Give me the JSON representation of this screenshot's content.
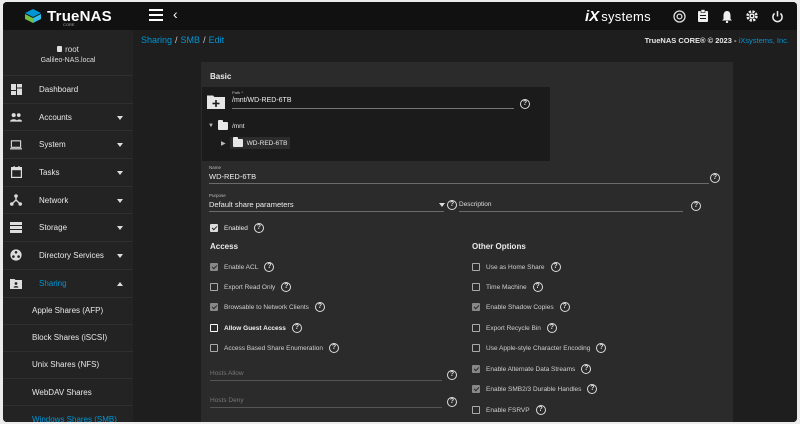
{
  "brand": {
    "name": "TrueNAS",
    "edition": "CORE"
  },
  "vendor": {
    "logo_prefix": "iX",
    "logo_suffix": "systems"
  },
  "user": {
    "name": "root",
    "host": "Galileo-NAS.local"
  },
  "sidebar": {
    "items": [
      {
        "label": "Dashboard",
        "icon": "dashboard-icon"
      },
      {
        "label": "Accounts",
        "icon": "people-icon"
      },
      {
        "label": "System",
        "icon": "laptop-icon"
      },
      {
        "label": "Tasks",
        "icon": "calendar-icon"
      },
      {
        "label": "Network",
        "icon": "network-icon"
      },
      {
        "label": "Storage",
        "icon": "storage-icon"
      },
      {
        "label": "Directory Services",
        "icon": "directory-icon"
      },
      {
        "label": "Sharing",
        "icon": "share-folder-icon"
      }
    ],
    "sub_items": [
      {
        "label": "Apple Shares (AFP)"
      },
      {
        "label": "Block Shares (iSCSI)"
      },
      {
        "label": "Unix Shares (NFS)"
      },
      {
        "label": "WebDAV Shares"
      },
      {
        "label": "Windows Shares (SMB)"
      }
    ]
  },
  "breadcrumb": {
    "part1": "Sharing",
    "part2": "SMB",
    "part3": "Edit",
    "sep": "/"
  },
  "copyright": {
    "text": "TrueNAS CORE® © 2023 - ",
    "link": "iXsystems, Inc."
  },
  "form": {
    "basic_title": "Basic",
    "path_label": "Path *",
    "path_value": "/mnt/WD-RED-6TB",
    "tree_root": "/mnt",
    "tree_child": "WD-RED-6TB",
    "name_label": "Name",
    "name_value": "WD-RED-6TB",
    "purpose_label": "Purpose",
    "purpose_value": "Default share parameters",
    "description_placeholder": "Description",
    "enabled_label": "Enabled",
    "access_title": "Access",
    "other_title": "Other Options",
    "access": [
      {
        "label": "Enable ACL",
        "checked": true
      },
      {
        "label": "Export Read Only",
        "checked": false
      },
      {
        "label": "Browsable to Network Clients",
        "checked": true
      },
      {
        "label": "Allow Guest Access",
        "checked": false
      },
      {
        "label": "Access Based Share Enumeration",
        "checked": false
      }
    ],
    "hosts_allow_placeholder": "Hosts Allow",
    "hosts_deny_placeholder": "Hosts Deny",
    "other": [
      {
        "label": "Use as Home Share",
        "checked": false
      },
      {
        "label": "Time Machine",
        "checked": false
      },
      {
        "label": "Enable Shadow Copies",
        "checked": true
      },
      {
        "label": "Export Recycle Bin",
        "checked": false
      },
      {
        "label": "Use Apple-style Character Encoding",
        "checked": false
      },
      {
        "label": "Enable Alternate Data Streams",
        "checked": true
      },
      {
        "label": "Enable SMB2/3 Durable Handles",
        "checked": true
      },
      {
        "label": "Enable FSRVP",
        "checked": false
      }
    ]
  },
  "colors": {
    "accent": "#0095d5",
    "sidebar": "#232323",
    "card": "#2b2b2b",
    "topbar": "#111111"
  }
}
